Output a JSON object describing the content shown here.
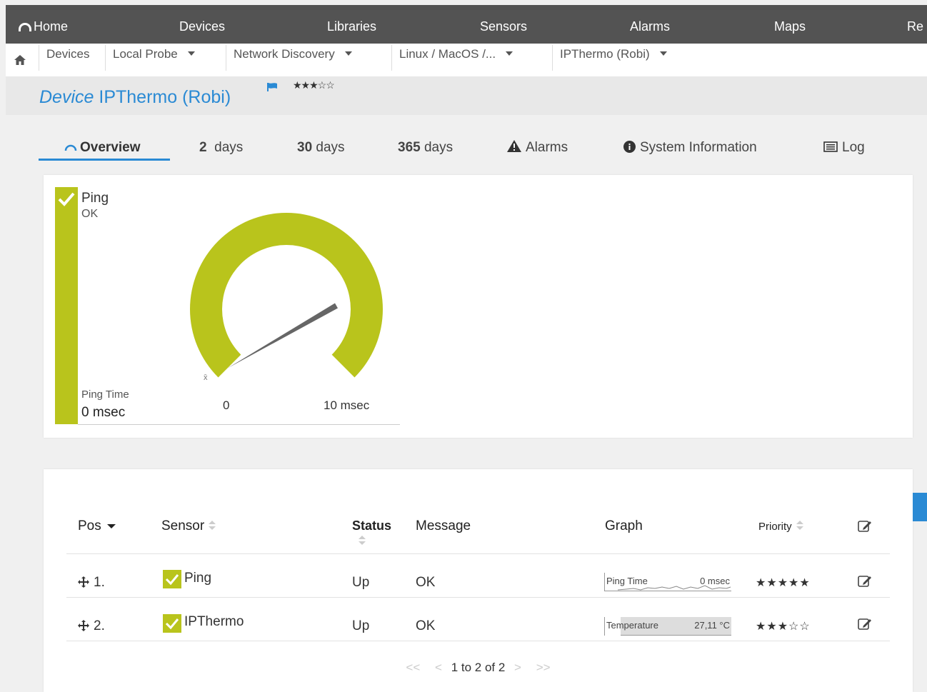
{
  "nav": {
    "home": "Home",
    "items": [
      "Devices",
      "Libraries",
      "Sensors",
      "Alarms",
      "Maps",
      "Re"
    ]
  },
  "breadcrumb": {
    "items": [
      "Devices",
      "Local Probe",
      "Network Discovery",
      "Linux / MacOS /...",
      "IPThermo (Robi)"
    ]
  },
  "page": {
    "type_label": "Device",
    "name": "IPThermo (Robi)",
    "stars": "★★★☆☆"
  },
  "tabs": {
    "overview": "Overview",
    "d2_num": "2",
    "d2_unit": "days",
    "d30_num": "30",
    "d30_unit": "days",
    "d365_num": "365",
    "d365_unit": "days",
    "alarms": "Alarms",
    "sysinfo": "System Information",
    "log": "Log"
  },
  "gauge": {
    "sensor": "Ping",
    "state": "OK",
    "channel_label": "Ping Time",
    "channel_value": "0 msec",
    "min_label": "0",
    "max_label": "10 msec",
    "avg_symbol": "x̄",
    "value_fraction": 0.0,
    "color": "#b9c41c"
  },
  "table": {
    "headers": {
      "pos": "Pos",
      "sensor": "Sensor",
      "status": "Status",
      "message": "Message",
      "graph": "Graph",
      "priority": "Priority"
    },
    "rows": [
      {
        "pos": "1.",
        "sensor": "Ping",
        "status": "Up",
        "message": "OK",
        "graph_label": "Ping Time",
        "graph_value": "0 msec",
        "priority": "★★★★★"
      },
      {
        "pos": "2.",
        "sensor": "IPThermo",
        "status": "Up",
        "message": "OK",
        "graph_label": "Temperature",
        "graph_value": "27,11 °C",
        "priority": "★★★☆☆"
      }
    ],
    "pager": "1 to 2 of 2"
  },
  "colors": {
    "accent": "#2a8ad4",
    "status_ok": "#b9c41c",
    "nav_bg": "#535353"
  }
}
